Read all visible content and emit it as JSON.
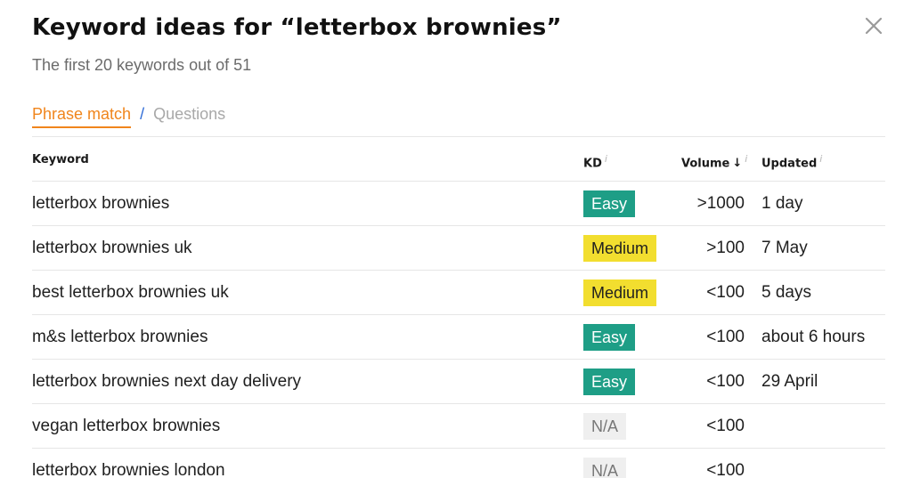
{
  "header": {
    "title": "Keyword ideas for “letterbox brownies”",
    "subtitle": "The first 20 keywords out of 51"
  },
  "tabs": {
    "active": "Phrase match",
    "separator": "/",
    "inactive": "Questions"
  },
  "table": {
    "columns": {
      "keyword": "Keyword",
      "kd": "KD",
      "volume": "Volume",
      "updated": "Updated",
      "info_mark": "i",
      "sort_arrow": "↓"
    },
    "rows": [
      {
        "keyword": "letterbox brownies",
        "kd": "Easy",
        "kd_level": "easy",
        "volume": ">1000",
        "updated": "1 day"
      },
      {
        "keyword": "letterbox brownies uk",
        "kd": "Medium",
        "kd_level": "medium",
        "volume": ">100",
        "updated": "7 May"
      },
      {
        "keyword": "best letterbox brownies uk",
        "kd": "Medium",
        "kd_level": "medium",
        "volume": "<100",
        "updated": "5 days"
      },
      {
        "keyword": "m&s letterbox brownies",
        "kd": "Easy",
        "kd_level": "easy",
        "volume": "<100",
        "updated": "about 6 hours"
      },
      {
        "keyword": "letterbox brownies next day delivery",
        "kd": "Easy",
        "kd_level": "easy",
        "volume": "<100",
        "updated": "29 April"
      },
      {
        "keyword": "vegan letterbox brownies",
        "kd": "N/A",
        "kd_level": "na",
        "volume": "<100",
        "updated": ""
      },
      {
        "keyword": "letterbox brownies london",
        "kd": "N/A",
        "kd_level": "na",
        "volume": "<100",
        "updated": ""
      }
    ]
  },
  "colors": {
    "accent": "#f0851c",
    "easy": "#1e9e86",
    "medium": "#f2de2f",
    "na": "#efefef"
  },
  "icons": {
    "close": "close-icon"
  }
}
